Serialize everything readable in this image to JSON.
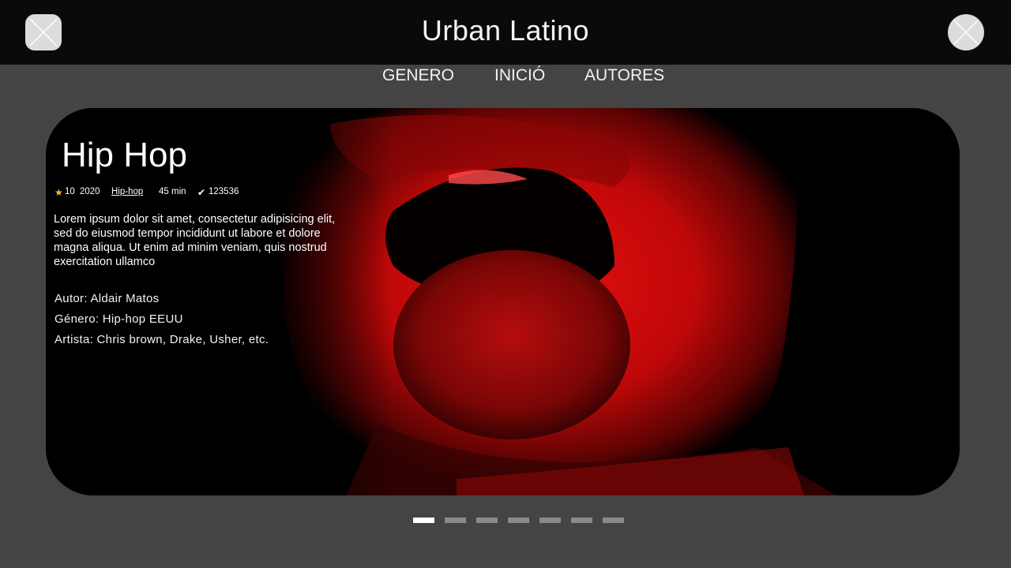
{
  "header": {
    "title": "Urban Latino",
    "left_button_icon": "close-icon",
    "right_button_icon": "close-icon"
  },
  "nav": {
    "items": [
      {
        "label": "GENERO"
      },
      {
        "label": "INICIÓ"
      },
      {
        "label": "AUTORES"
      }
    ]
  },
  "hero": {
    "title": "Hip Hop",
    "rating_icon": "star-icon",
    "rating": "10",
    "year": "2020",
    "genre_link": "Hip-hop",
    "duration": "45 min",
    "views_icon": "check-icon",
    "views": "123536",
    "description": "Lorem ipsum dolor sit amet, consectetur adipisicing elit, sed do eiusmod tempor incididunt ut labore et dolore magna aliqua. Ut enim ad minim veniam, quis nostrud exercitation ullamco",
    "autor": "Autor: Aldair Matos",
    "genero": "Género: Hip-hop EEUU",
    "artista": "Artista: Chris brown, Drake, Usher, etc.",
    "image": "red-tinted-open-mouth-photo"
  },
  "carousel": {
    "total_slides": 7,
    "active_index": 0
  },
  "colors": {
    "header_bg": "#0a0a0b",
    "page_bg": "#444444",
    "accent_red": "#d10d0d",
    "star": "#f5b928"
  }
}
